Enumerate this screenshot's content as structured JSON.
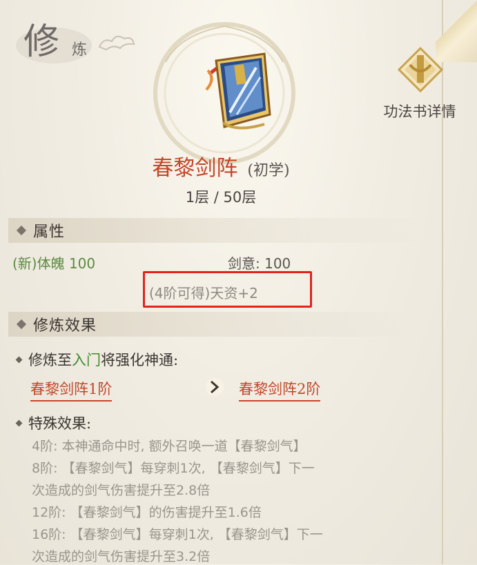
{
  "header": {
    "title_big": "修",
    "title_small": "炼"
  },
  "detail_button": {
    "label": "功法书详情",
    "icon": "crest-emblem-icon"
  },
  "skill": {
    "name": "春黎剑阵",
    "level_tag": "(初学)",
    "layer": "1层 / 50层",
    "icon": "skill-book-icon"
  },
  "attributes": {
    "section_title": "属性",
    "left_stat": "(新)体魄 100",
    "right_stat": "剑意: 100",
    "note": "(4阶可得)天资+2"
  },
  "effects": {
    "section_title": "修炼效果",
    "upgrade_prefix": "修炼至",
    "upgrade_stage": "入门",
    "upgrade_suffix": "将强化神通:",
    "from_skill": "春黎剑阵1阶",
    "to_skill": "春黎剑阵2阶",
    "special_title": "特殊效果:",
    "special_lines": [
      "4阶: 本神通命中时, 额外召唤一道【春黎剑气】",
      "8阶: 【春黎剑气】每穿刺1次, 【春黎剑气】下一",
      "次造成的剑气伤害提升至2.8倍",
      "12阶: 【春黎剑气】的伤害提升至1.6倍",
      "16阶: 【春黎剑气】每穿刺1次, 【春黎剑气】下一",
      "次造成的剑气伤害提升至3.2倍"
    ]
  },
  "colors": {
    "accent_red": "#c4462a",
    "stat_green": "#5a8a3e",
    "highlight_border": "#e0241c"
  }
}
